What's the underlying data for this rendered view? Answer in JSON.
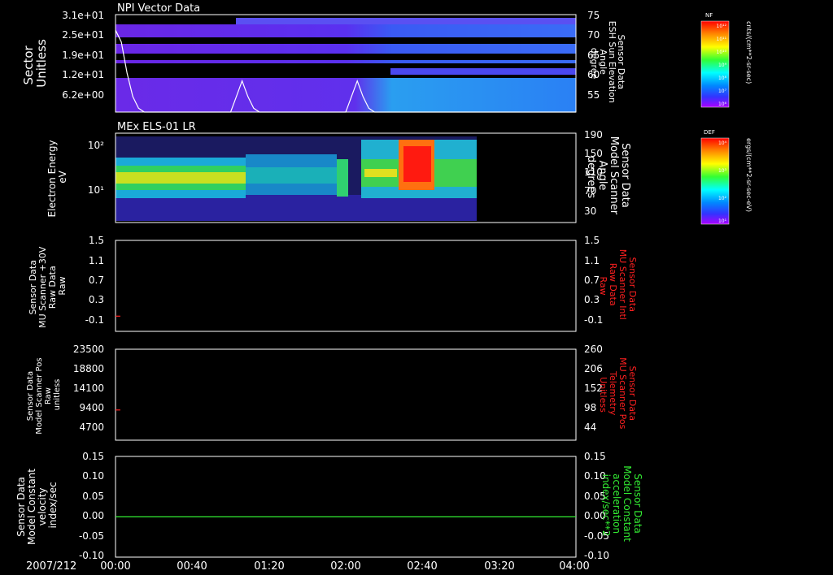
{
  "colors": {
    "background": "#000000",
    "foreground": "#ffffff",
    "red_label": "#ff2020",
    "green_label": "#33ee33",
    "trace": "#ffffff"
  },
  "footer": {
    "date": "2007/212",
    "time_ticks": [
      "00:00",
      "00:40",
      "01:20",
      "02:00",
      "02:40",
      "03:20",
      "04:00"
    ]
  },
  "chart_data": [
    {
      "id": "panel1",
      "type": "heatmap",
      "title": "NPI Vector Data",
      "ylabel_left": [
        "Sector",
        "Unitless"
      ],
      "yticks_left": [
        "3.1e+01",
        "2.5e+01",
        "1.9e+01",
        "1.2e+01",
        "6.2e+00"
      ],
      "ylabel_right": [
        "Sensor Data",
        "ESH Sun Elevation",
        "Angle",
        "degree"
      ],
      "yticks_right": [
        "75",
        "70",
        "65",
        "60",
        "55"
      ],
      "ylim_right": [
        50,
        75
      ],
      "colorbar": {
        "label": "NF",
        "unit": "cnts/(cm**2-sr-sec)",
        "ticks": [
          "10¹²",
          "10¹¹",
          "10¹⁰",
          "10⁹",
          "10⁸",
          "10⁷",
          "10⁶"
        ]
      },
      "overlay_line": {
        "name": "ESH Sun Elevation Angle",
        "x_minutes": [
          0,
          3,
          6,
          9,
          12,
          15,
          20,
          60,
          63,
          66,
          69,
          72,
          75,
          120,
          123,
          126,
          129,
          132,
          135,
          240
        ],
        "y_degrees": [
          71,
          68,
          60,
          54,
          51,
          50,
          50,
          50,
          54,
          58,
          54,
          51,
          50,
          50,
          54,
          58,
          54,
          51,
          50,
          50
        ]
      }
    },
    {
      "id": "panel2",
      "type": "heatmap",
      "title": "MEx ELS-01 LR",
      "ylabel_left": [
        "Electron Energy",
        "eV"
      ],
      "yticks_left": [
        "10²",
        "10¹"
      ],
      "ylabel_right": [
        "Sensor Data",
        "Model Scanner",
        "Angle",
        "degrees"
      ],
      "yticks_right": [
        "190",
        "150",
        "110",
        "70",
        "30"
      ],
      "colorbar": {
        "label": "DEF",
        "unit": "ergs/(cm**2-sr-sec-eV)",
        "ticks": [
          "10⁴",
          "10³",
          "10²",
          "10¹"
        ]
      }
    },
    {
      "id": "panel3",
      "type": "line",
      "ylabel_left": [
        "Sensor Data",
        "MU Scanner +30V",
        "Raw Data",
        "Raw"
      ],
      "yticks_left": [
        "1.5",
        "1.1",
        "0.7",
        "0.3",
        "-0.1"
      ],
      "ylim_left": [
        -0.3,
        1.5
      ],
      "ylabel_right": [
        "Sensor Data",
        "MU Scanner Intl",
        "Raw Data",
        "Raw"
      ],
      "yticks_right": [
        "1.5",
        "1.1",
        "0.7",
        "0.3",
        "-0.1"
      ],
      "right_label_color": "red",
      "series": [
        {
          "x_minutes": [
            0,
            2.5
          ],
          "y": [
            0.0,
            0.0
          ],
          "color": "#ff2020"
        }
      ]
    },
    {
      "id": "panel4",
      "type": "line",
      "ylabel_left": [
        "Sensor Data",
        "Model Scanner Pos",
        "Raw",
        "unitless"
      ],
      "yticks_left": [
        "23500",
        "18800",
        "14100",
        "9400",
        "4700"
      ],
      "ylim_left": [
        0,
        23500
      ],
      "ylabel_right": [
        "Sensor Data",
        "MU Scanner Pos",
        "Telemetry",
        "Unitless"
      ],
      "yticks_right": [
        "260",
        "206",
        "152",
        "98",
        "44"
      ],
      "right_label_color": "red",
      "series": [
        {
          "x_minutes": [
            0,
            2.5
          ],
          "y": [
            7800,
            7800
          ],
          "color": "#ff2020"
        }
      ]
    },
    {
      "id": "panel5",
      "type": "line",
      "ylabel_left": [
        "Sensor Data",
        "Model Constant",
        "velocity",
        "index/sec"
      ],
      "yticks_left": [
        "0.15",
        "0.10",
        "0.05",
        "0.00",
        "-0.05",
        "-0.10"
      ],
      "ylim_left": [
        -0.1,
        0.15
      ],
      "ylabel_right": [
        "Sensor Data",
        "Model Constant",
        "acceleration",
        "index/sec**2"
      ],
      "yticks_right": [
        "0.15",
        "0.10",
        "0.05",
        "0.00",
        "-0.05",
        "-0.10"
      ],
      "right_label_color": "green",
      "series": [
        {
          "x_minutes": [
            0,
            240
          ],
          "y": [
            0.0,
            0.0
          ],
          "color": "#33ee33"
        }
      ]
    }
  ]
}
